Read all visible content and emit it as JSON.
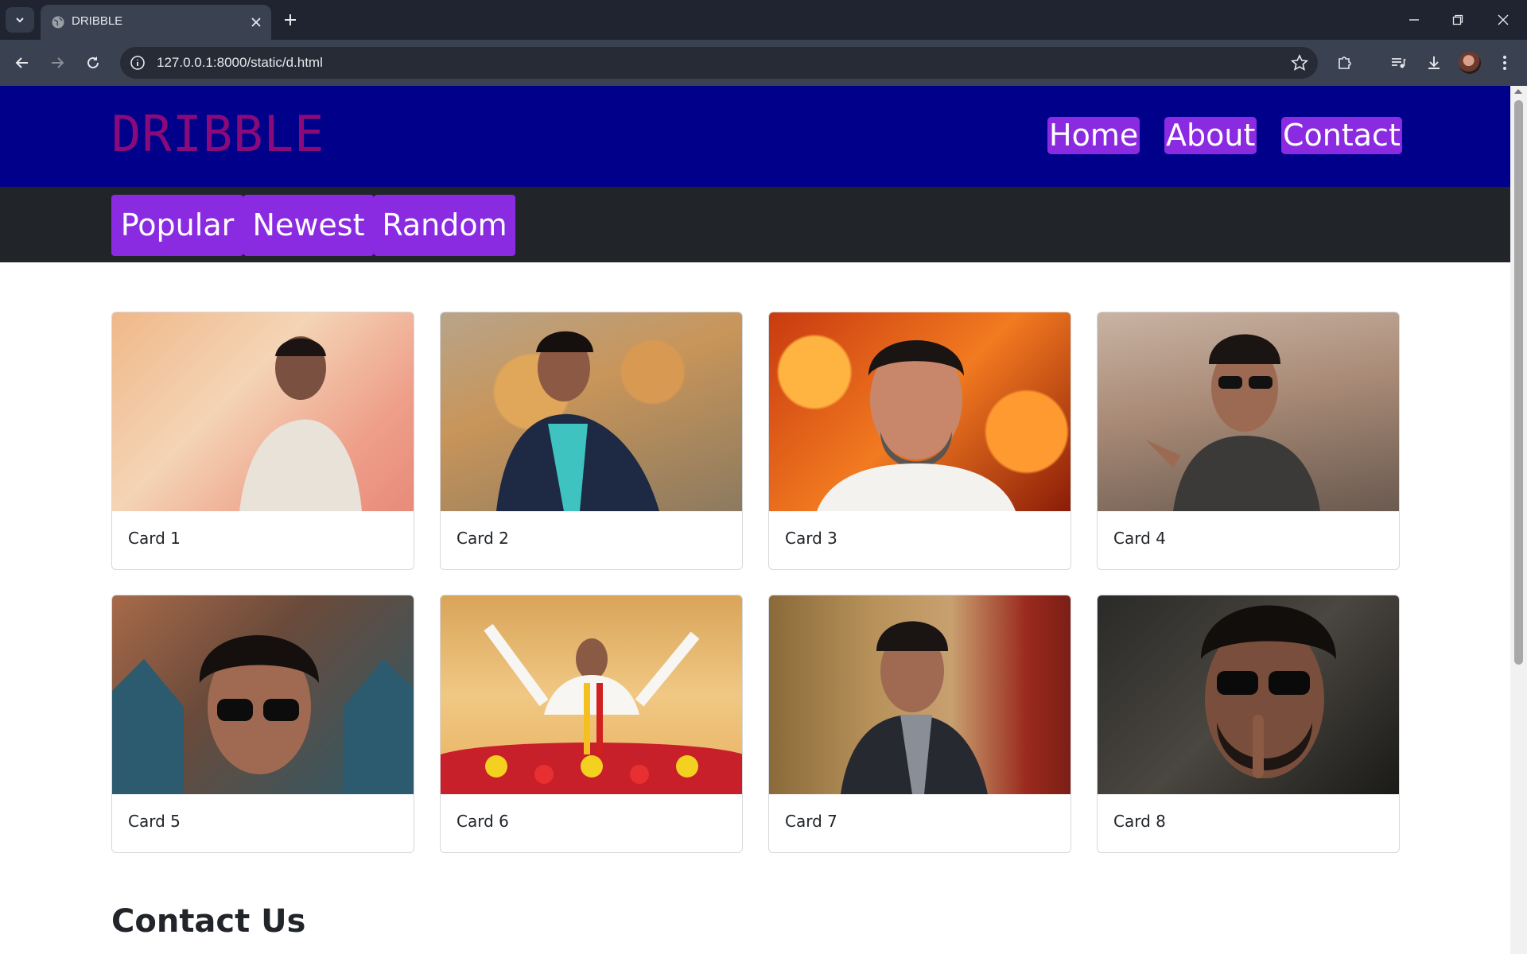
{
  "browser": {
    "tab_title": "DRIBBLE",
    "url": "127.0.0.1:8000/static/d.html"
  },
  "site": {
    "logo": "DRIBBLE",
    "nav": [
      "Home",
      "About",
      "Contact"
    ],
    "filters": [
      "Popular",
      "Newest",
      "Random"
    ],
    "cards": [
      "Card 1",
      "Card 2",
      "Card 3",
      "Card 4",
      "Card 5",
      "Card 6",
      "Card 7",
      "Card 8"
    ],
    "contact_heading": "Contact Us"
  },
  "colors": {
    "header_bg": "#00008b",
    "logo": "#8b0a7a",
    "accent": "#8a2be2",
    "filter_bar_bg": "#212529"
  }
}
